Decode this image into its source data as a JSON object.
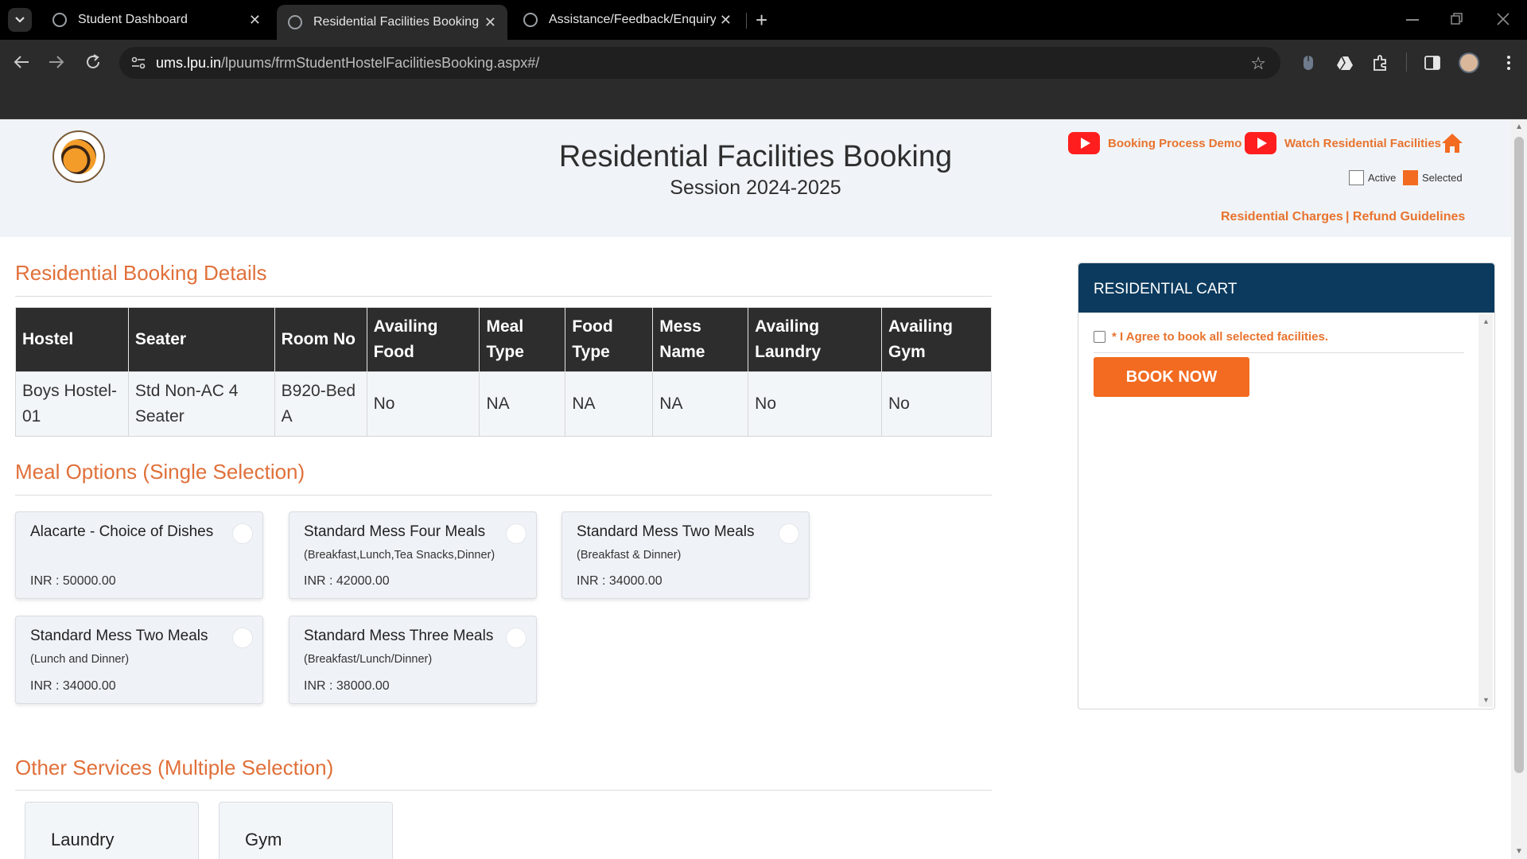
{
  "browser": {
    "tabs": [
      {
        "title": "Student Dashboard",
        "active": false
      },
      {
        "title": "Residential Facilities Booking",
        "active": true
      },
      {
        "title": "Assistance/Feedback/Enquiry/M",
        "active": false
      }
    ],
    "new_tab": "+",
    "close_glyph": "✕",
    "url_host": "ums.lpu.in",
    "url_path": "/lpuums/frmStudentHostelFacilitiesBooking.aspx#/"
  },
  "header": {
    "title": "Residential Facilities Booking",
    "session": "Session 2024-2025",
    "links": {
      "booking_demo": "Booking Process Demo",
      "watch_facilities": "Watch Residential Facilities",
      "residential_charges": "Residential Charges",
      "refund_guidelines": "| Refund Guidelines"
    },
    "legend": {
      "active": "Active",
      "selected": "Selected"
    },
    "colors": {
      "accent": "#e8732e",
      "selected": "#f26b21",
      "youtube": "#ff1e1e"
    }
  },
  "booking_details": {
    "title": "Residential Booking Details",
    "columns": [
      "Hostel",
      "Seater",
      "Room No",
      "Availing Food",
      "Meal Type",
      "Food Type",
      "Mess Name",
      "Availing Laundry",
      "Availing Gym"
    ],
    "row": [
      "Boys Hostel-01",
      "Std Non-AC 4 Seater",
      "B920-Bed A",
      "No",
      "NA",
      "NA",
      "NA",
      "No",
      "No"
    ]
  },
  "meal_options": {
    "title": "Meal Options (Single Selection)",
    "items": [
      {
        "name": "Alacarte - Choice of Dishes",
        "desc": "",
        "price": "INR : 50000.00"
      },
      {
        "name": "Standard Mess Four Meals",
        "desc": "(Breakfast,Lunch,Tea Snacks,Dinner)",
        "price": "INR : 42000.00"
      },
      {
        "name": "Standard Mess Two Meals",
        "desc": "(Breakfast & Dinner)",
        "price": "INR : 34000.00"
      },
      {
        "name": "Standard Mess Two Meals",
        "desc": "(Lunch and Dinner)",
        "price": "INR : 34000.00"
      },
      {
        "name": "Standard Mess Three Meals",
        "desc": "(Breakfast/Lunch/Dinner)",
        "price": "INR : 38000.00"
      }
    ]
  },
  "other_services": {
    "title": "Other Services (Multiple Selection)",
    "items": [
      "Laundry",
      "Gym"
    ]
  },
  "cart": {
    "title": "RESIDENTIAL CART",
    "agree_text": "* I Agree to book all selected facilities.",
    "book_button": "BOOK NOW"
  }
}
